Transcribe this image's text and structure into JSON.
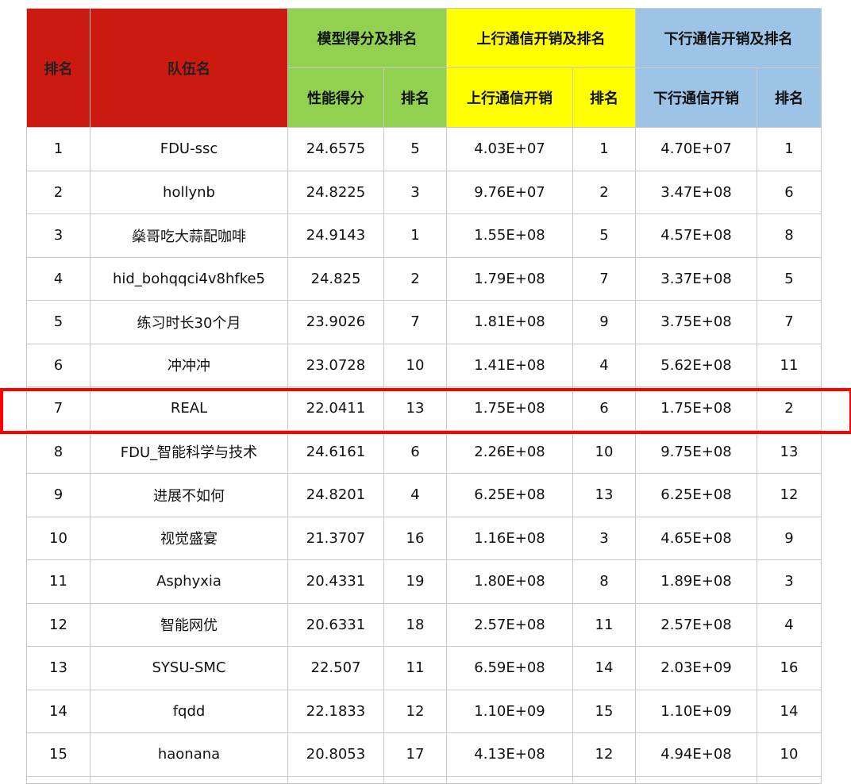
{
  "headers": {
    "rank": "排名",
    "team": "队伍名",
    "model_group": "模型得分及排名",
    "uplink_group": "上行通信开销及排名",
    "downlink_group": "下行通信开销及排名",
    "perf_score": "性能得分",
    "rank_a": "排名",
    "uplink_cost": "上行通信开销",
    "rank_b": "排名",
    "downlink_cost": "下行通信开销",
    "rank_c": "排名"
  },
  "colors": {
    "red": "#cc1a10",
    "green": "#92d050",
    "yellow": "#ffff00",
    "blue": "#9dc3e6",
    "highlight": "#ff0000"
  },
  "highlighted_row": 7,
  "rows": [
    [
      "1",
      "FDU-ssc",
      "24.6575",
      "5",
      "4.03E+07",
      "1",
      "4.70E+07",
      "1"
    ],
    [
      "2",
      "hollynb",
      "24.8225",
      "3",
      "9.76E+07",
      "2",
      "3.47E+08",
      "6"
    ],
    [
      "3",
      "燊哥吃大蒜配咖啡",
      "24.9143",
      "1",
      "1.55E+08",
      "5",
      "4.57E+08",
      "8"
    ],
    [
      "4",
      "hid_bohqqci4v8hfke5",
      "24.825",
      "2",
      "1.79E+08",
      "7",
      "3.37E+08",
      "5"
    ],
    [
      "5",
      "练习时长30个月",
      "23.9026",
      "7",
      "1.81E+08",
      "9",
      "3.75E+08",
      "7"
    ],
    [
      "6",
      "冲冲冲",
      "23.0728",
      "10",
      "1.41E+08",
      "4",
      "5.62E+08",
      "11"
    ],
    [
      "7",
      "REAL",
      "22.0411",
      "13",
      "1.75E+08",
      "6",
      "1.75E+08",
      "2"
    ],
    [
      "8",
      "FDU_智能科学与技术",
      "24.6161",
      "6",
      "2.26E+08",
      "10",
      "9.75E+08",
      "13"
    ],
    [
      "9",
      "进展不如何",
      "24.8201",
      "4",
      "6.25E+08",
      "13",
      "6.25E+08",
      "12"
    ],
    [
      "10",
      "视觉盛宴",
      "21.3707",
      "16",
      "1.16E+08",
      "3",
      "4.65E+08",
      "9"
    ],
    [
      "11",
      "Asphyxia",
      "20.4331",
      "19",
      "1.80E+08",
      "8",
      "1.89E+08",
      "3"
    ],
    [
      "12",
      "智能网优",
      "20.6331",
      "18",
      "2.57E+08",
      "11",
      "2.57E+08",
      "4"
    ],
    [
      "13",
      "SYSU-SMC",
      "22.507",
      "11",
      "6.59E+08",
      "14",
      "2.03E+09",
      "16"
    ],
    [
      "14",
      "fqdd",
      "22.1833",
      "12",
      "1.10E+09",
      "15",
      "1.10E+09",
      "14"
    ],
    [
      "15",
      "haonana",
      "20.8053",
      "17",
      "4.13E+08",
      "12",
      "4.94E+08",
      "10"
    ]
  ]
}
